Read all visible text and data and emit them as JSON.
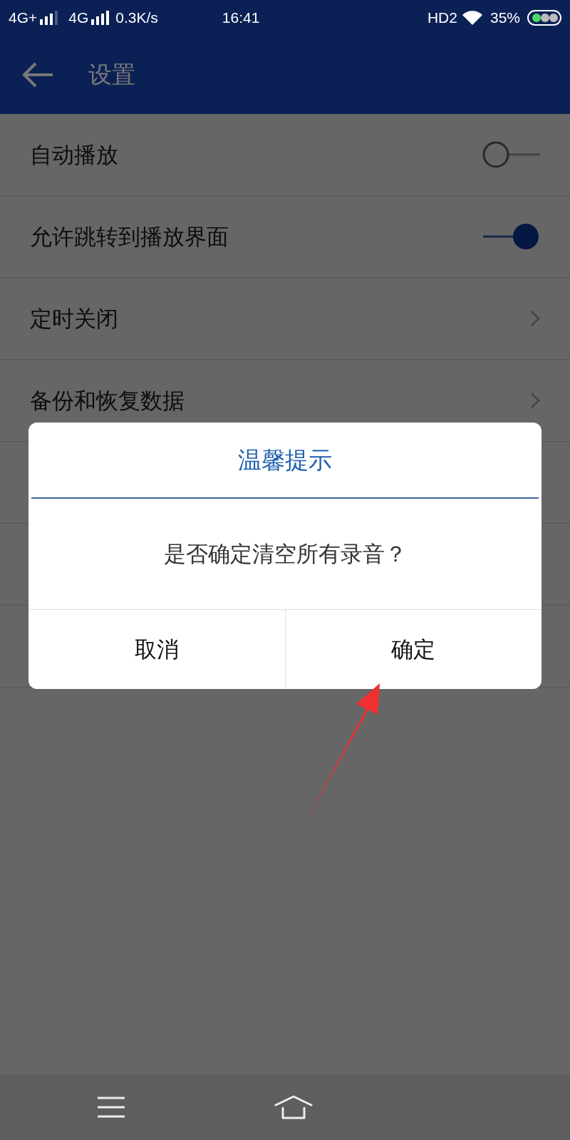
{
  "status_bar": {
    "sim1": "4G+",
    "sim2": "4G",
    "speed": "0.3K/s",
    "time": "16:41",
    "hd": "HD2",
    "battery": "35%"
  },
  "app_bar": {
    "title": "设置"
  },
  "settings": [
    {
      "label": "自动播放",
      "kind": "toggle",
      "on": false
    },
    {
      "label": "允许跳转到播放界面",
      "kind": "toggle",
      "on": true
    },
    {
      "label": "定时关闭",
      "kind": "link"
    },
    {
      "label": "备份和恢复数据",
      "kind": "link"
    }
  ],
  "dialog": {
    "title": "温馨提示",
    "message": "是否确定清空所有录音？",
    "buttons": [
      "取消",
      "确定"
    ]
  }
}
